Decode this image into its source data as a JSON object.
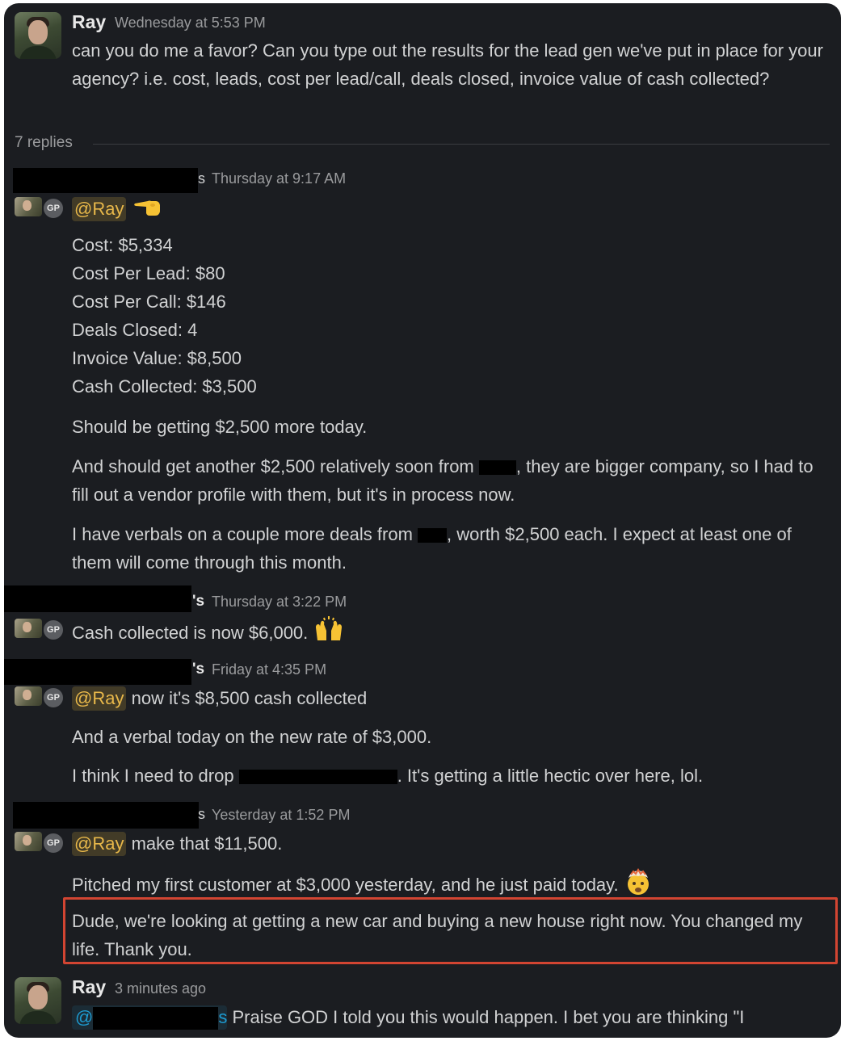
{
  "thread": {
    "parent": {
      "author": "Ray",
      "timestamp": "Wednesday at 5:53 PM",
      "text": "can you do me a favor? Can you type out the results for the lead gen we've put in place for your agency? i.e. cost, leads, cost per lead/call, deals closed, invoice value of cash collected?"
    },
    "reply_count": "7 replies"
  },
  "messages": [
    {
      "author_suffix": "s",
      "timestamp": "Thursday at 9:17 AM",
      "mention": "@Ray",
      "stats": [
        "Cost: $5,334",
        "Cost Per Lead: $80",
        "Cost Per Call: $146",
        "Deals Closed: 4",
        "Invoice Value: $8,500",
        "Cash Collected: $3,500"
      ],
      "para1": "Should be getting $2,500 more today.",
      "para2": "And should get another $2,500 relatively soon from",
      "para2b": ", they are bigger company, so I had to fill out a vendor profile with them, but it's in process now.",
      "para3": "I have verbals on a couple more deals from",
      "para3b": ", worth $2,500 each. I expect at least one of them will come through this month."
    },
    {
      "author_suffix": "'s",
      "timestamp": "Thursday at 3:22 PM",
      "text": "Cash collected is now $6,000."
    },
    {
      "author_suffix": "'s",
      "timestamp": "Friday at 4:35 PM",
      "mention": "@Ray",
      "text": "now it's $8,500 cash collected",
      "para1": "And a verbal today on the new rate of $3,000.",
      "para2": "I think I need to drop",
      "para2b": ". It's getting a little hectic over here, lol."
    },
    {
      "author_suffix": "s",
      "timestamp": "Yesterday at 1:52 PM",
      "mention": "@Ray",
      "text": "make that $11,500.",
      "para1": "Pitched my first customer at $3,000 yesterday, and he just paid today.",
      "para2": "Dude, we're looking at getting a new car and buying a new house right now. You changed my life. Thank you."
    }
  ],
  "last": {
    "author": "Ray",
    "timestamp": "3 minutes ago",
    "mention_prefix": "@",
    "mention_suffix": "s",
    "text": "Praise GOD I told you this would happen. I bet you are thinking \"I"
  },
  "badge": "GP",
  "colors": {
    "background": "#1b1d21",
    "text": "#d1d2d3",
    "mention": "#e8b84a",
    "highlight_border": "#d24532"
  }
}
